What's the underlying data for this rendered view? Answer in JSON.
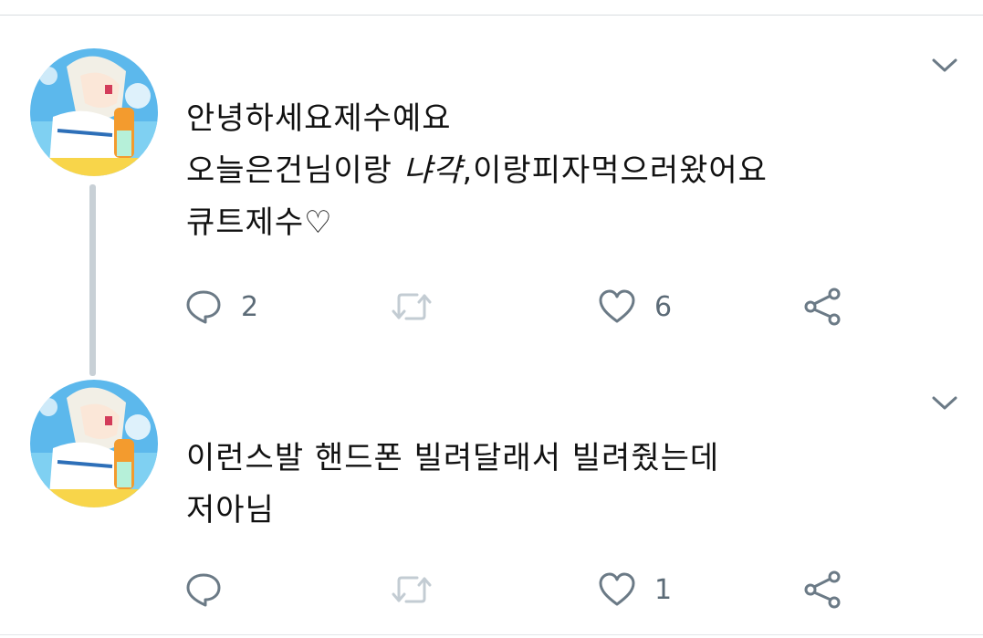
{
  "tweets": [
    {
      "text_lines": [
        "안녕하세요제수예요",
        "오늘은건님이랑 ",
        "냐갹",
        ",이랑피자먹으러왔어요",
        "큐트제수♡"
      ],
      "reply_count": "2",
      "retweet_count": "",
      "like_count": "6"
    },
    {
      "text_lines": [
        "이런스발 핸드폰 빌려달래서 빌려줬는데",
        "저아님"
      ],
      "reply_count": "",
      "retweet_count": "",
      "like_count": "1"
    }
  ],
  "colors": {
    "icon_gray": "#6b7a86",
    "thread_line": "#c8d0d6",
    "divider": "#d9dde0"
  },
  "icons": [
    "chevron-down-icon",
    "reply-icon",
    "retweet-icon",
    "like-icon",
    "share-icon"
  ]
}
